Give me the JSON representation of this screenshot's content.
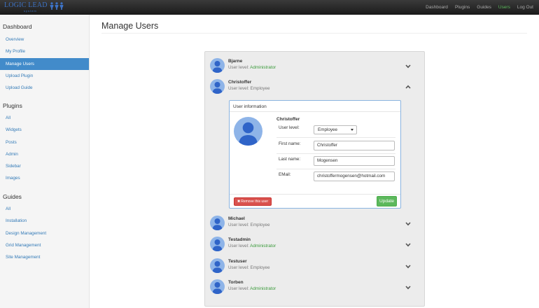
{
  "brand": {
    "logo_text": "LOGIC LEAD",
    "logo_subtext": "system"
  },
  "topnav": {
    "items": [
      {
        "label": "Dashboard",
        "active": false
      },
      {
        "label": "Plugins",
        "active": false
      },
      {
        "label": "Guides",
        "active": false
      },
      {
        "label": "Users",
        "active": true
      },
      {
        "label": "Log Out",
        "active": false
      }
    ],
    "active_color": "#5cb85c"
  },
  "sidebar": {
    "sections": [
      {
        "title": "Dashboard",
        "items": [
          {
            "label": "Overview",
            "active": false
          },
          {
            "label": "My Profile",
            "active": false
          },
          {
            "label": "Manage Users",
            "active": true
          },
          {
            "label": "Upload Plugin",
            "active": false
          },
          {
            "label": "Upload Guide",
            "active": false
          }
        ]
      },
      {
        "title": "Plugins",
        "items": [
          {
            "label": "All"
          },
          {
            "label": "Widgets"
          },
          {
            "label": "Posts"
          },
          {
            "label": "Admin"
          },
          {
            "label": "Sidebar"
          },
          {
            "label": "Images"
          }
        ]
      },
      {
        "title": "Guides",
        "items": [
          {
            "label": "All"
          },
          {
            "label": "Installation"
          },
          {
            "label": "Design Management"
          },
          {
            "label": "Grid Management"
          },
          {
            "label": "Site Management"
          }
        ]
      }
    ],
    "active_color": "#428bca"
  },
  "page": {
    "title": "Manage Users"
  },
  "users": [
    {
      "name": "Bjarne",
      "level_prefix": "User level: ",
      "level": "Administrator",
      "admin": true,
      "expanded": false
    },
    {
      "name": "Christoffer",
      "level_prefix": "User level: ",
      "level": "Employee",
      "admin": false,
      "expanded": true
    },
    {
      "name": "Michael",
      "level_prefix": "User level: ",
      "level": "Employee",
      "admin": false,
      "expanded": false
    },
    {
      "name": "Testadmin",
      "level_prefix": "User level: ",
      "level": "Administrator",
      "admin": true,
      "expanded": false
    },
    {
      "name": "Testuser",
      "level_prefix": "User level: ",
      "level": "Employee",
      "admin": false,
      "expanded": false
    },
    {
      "name": "Torben",
      "level_prefix": "User level: ",
      "level": "Administrator",
      "admin": true,
      "expanded": false
    }
  ],
  "user_info": {
    "heading": "User information",
    "name": "Christoffer",
    "fields": {
      "user_level_label": "User level:",
      "user_level_value": "Employee",
      "first_name_label": "First name:",
      "first_name_value": "Christoffer",
      "last_name_label": "Last name:",
      "last_name_value": "Mogensen",
      "email_label": "EMail:",
      "email_value": "christoffermogensen@hotmail.com"
    },
    "remove_label": "Remove this user",
    "update_label": "Update",
    "remove_color": "#d9534f",
    "update_color": "#5cb85c"
  },
  "icons": {
    "avatar": "user-avatar-icon",
    "expand": "chevron-down-icon",
    "collapse": "chevron-up-icon",
    "remove": "close-icon",
    "select": "caret-down-icon"
  }
}
